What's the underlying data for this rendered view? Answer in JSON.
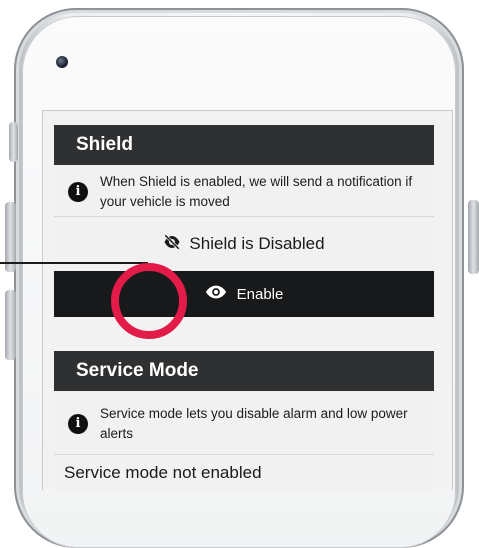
{
  "shield": {
    "title": "Shield",
    "info_text": "When Shield is enabled, we will send a notification if your vehicle is moved",
    "status_text": "Shield is Disabled",
    "enable_label": "Enable"
  },
  "service_mode": {
    "title": "Service Mode",
    "info_text": "Service mode lets you disable alarm and low power alerts",
    "status_text": "Service mode not enabled"
  },
  "icons": {
    "info": "info-icon",
    "eye_off": "eye-off-icon",
    "eye": "eye-icon",
    "camera": "front-camera"
  },
  "colors": {
    "header_bg": "#2e3031",
    "button_bg": "#17191a",
    "callout_ring": "#e21b49"
  }
}
